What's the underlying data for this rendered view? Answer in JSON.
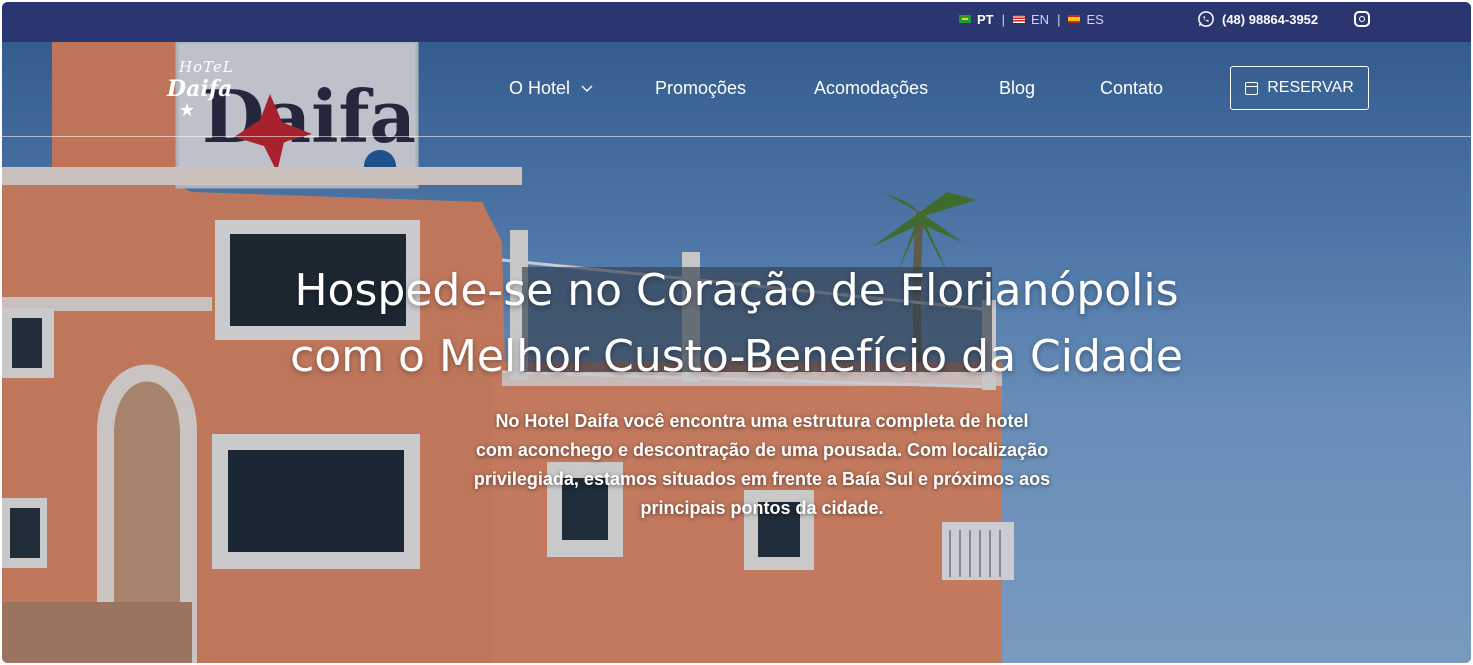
{
  "topbar": {
    "languages": [
      {
        "code": "PT",
        "flag_colors": [
          "#1f9a3b",
          "#f5d300"
        ],
        "active": true
      },
      {
        "code": "EN",
        "flag_colors": [
          "#c62828",
          "#ffffff"
        ],
        "active": false
      },
      {
        "code": "ES",
        "flag_colors": [
          "#c62828",
          "#f5c400"
        ],
        "active": false
      }
    ],
    "separator": "|",
    "phone": "(48) 98864-3952",
    "phone_icon": "whatsapp-icon",
    "social_icon": "instagram-icon"
  },
  "nav": {
    "logo": {
      "line1": "HoTeL",
      "line2": "Daifa"
    },
    "items": [
      {
        "label": "O Hotel",
        "has_dropdown": true
      },
      {
        "label": "Promoções"
      },
      {
        "label": "Acomodações"
      },
      {
        "label": "Blog"
      },
      {
        "label": "Contato"
      }
    ],
    "dropdown_icon": "chevron-down-icon",
    "cta": {
      "label": "RESERVAR",
      "icon": "calendar-icon"
    }
  },
  "hero": {
    "title_line1": "Hospede-se no Coração de Florianópolis",
    "title_line2": "com o Melhor Custo-Benefício da Cidade",
    "subtitle_lines": [
      "No Hotel Daifa você encontra uma estrutura completa de hotel",
      "com aconchego e descontração de uma pousada. Com localização",
      "privilegiada, estamos situados em frente a Baía Sul e próximos aos",
      "principais pontos da cidade."
    ],
    "sign_text": "Daifa"
  },
  "colors": {
    "topbar_bg": "#2b3570",
    "building": "#e98f67",
    "sky": "#5e8fc2"
  }
}
